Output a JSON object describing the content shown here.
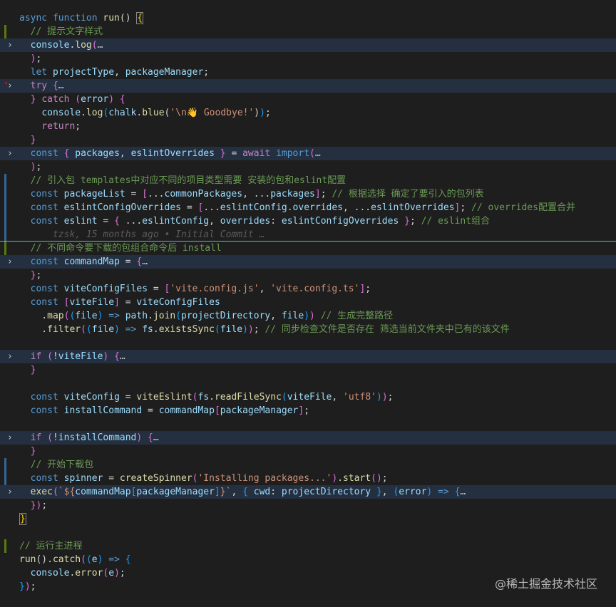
{
  "lines": [
    {
      "text": "async function run() {"
    },
    {
      "text": "  // 提示文字样式"
    },
    {
      "text": "  console.log(…"
    },
    {
      "text": "  );"
    },
    {
      "text": "  let projectType, packageManager;"
    },
    {
      "text": "  try {…"
    },
    {
      "text": "  } catch (error) {"
    },
    {
      "text": "    console.log(chalk.blue('\\n👋 Goodbye!'));"
    },
    {
      "text": "    return;"
    },
    {
      "text": "  }"
    },
    {
      "text": "  const { packages, eslintOverrides } = await import(…"
    },
    {
      "text": "  );"
    },
    {
      "text": "  // 引入包 templates中对应不同的项目类型需要 安装的包和eslint配置"
    },
    {
      "text": "  const packageList = [...commonPackages, ...packages]; // 根据选择 确定了要引入的包列表"
    },
    {
      "text": "  const eslintConfigOverrides = [...eslintConfig.overrides, ...eslintOverrides]; // overrides配置合并"
    },
    {
      "text": "  const eslint = { ...eslintConfig, overrides: eslintConfigOverrides }; // eslint组合"
    },
    {
      "text": "      tzsk, 15 months ago • Initial Commit …"
    },
    {
      "text": "  // 不同命令要下载的包组合命令后 install"
    },
    {
      "text": "  const commandMap = {…"
    },
    {
      "text": "  };"
    },
    {
      "text": "  const viteConfigFiles = ['vite.config.js', 'vite.config.ts'];"
    },
    {
      "text": "  const [viteFile] = viteConfigFiles"
    },
    {
      "text": "    .map((file) => path.join(projectDirectory, file)) // 生成完整路径"
    },
    {
      "text": "    .filter((file) => fs.existsSync(file)); // 同步检查文件是否存在 筛选当前文件夹中已有的该文件"
    },
    {
      "text": ""
    },
    {
      "text": "  if (!viteFile) {…"
    },
    {
      "text": "  }"
    },
    {
      "text": ""
    },
    {
      "text": "  const viteConfig = viteEslint(fs.readFileSync(viteFile, 'utf8'));"
    },
    {
      "text": "  const installCommand = commandMap[packageManager];"
    },
    {
      "text": ""
    },
    {
      "text": "  if (!installCommand) {…"
    },
    {
      "text": "  }"
    },
    {
      "text": "  // 开始下载包"
    },
    {
      "text": "  const spinner = createSpinner('Installing packages...').start();"
    },
    {
      "text": "  exec(`${commandMap[packageManager]}`, { cwd: projectDirectory }, (error) => {…"
    },
    {
      "text": "  });"
    },
    {
      "text": "}"
    },
    {
      "text": ""
    },
    {
      "text": "// 运行主进程"
    },
    {
      "text": "run().catch((e) => {"
    },
    {
      "text": "  console.error(e);"
    },
    {
      "text": "});"
    }
  ],
  "watermark": "@稀土掘金技术社区",
  "colors": {
    "background": "#1e1e1e",
    "folded_line": "#243040",
    "comment": "#6a9955",
    "keyword": "#569cd6",
    "function": "#dcdcaa",
    "variable": "#9cdcfe",
    "string": "#ce9178",
    "separator": "#4ec9b0"
  }
}
